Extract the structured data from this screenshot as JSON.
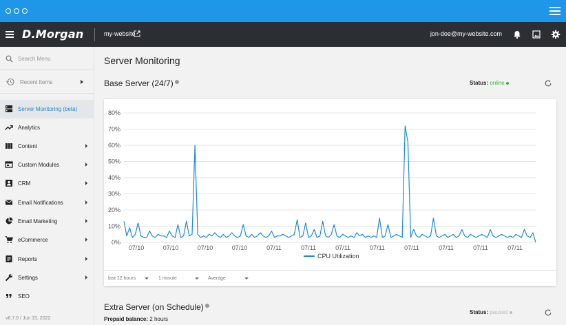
{
  "browser": {
    "menu_icon": "hamburger-icon"
  },
  "topnav": {
    "logo": "D.Morgan",
    "site": "my-website",
    "email": "jon-doe@my-website.com",
    "icons": [
      "bell-icon",
      "image-icon",
      "gear-icon"
    ]
  },
  "sidebar": {
    "search_placeholder": "Search Menu",
    "recent_label": "Recent Items",
    "items": [
      {
        "label": "Server Monitoring (beta)",
        "icon": "server-icon",
        "active": true
      },
      {
        "label": "Analytics",
        "icon": "trend-icon"
      },
      {
        "label": "Content",
        "icon": "columns-icon"
      },
      {
        "label": "Custom Modules",
        "icon": "module-icon"
      },
      {
        "label": "CRM",
        "icon": "contact-icon"
      },
      {
        "label": "Email Notifications",
        "icon": "mail-icon"
      },
      {
        "label": "Email Marketing",
        "icon": "pie-icon"
      },
      {
        "label": "eCommerce",
        "icon": "cart-icon"
      },
      {
        "label": "Reports",
        "icon": "report-icon"
      },
      {
        "label": "Settings",
        "icon": "wrench-icon"
      },
      {
        "label": "SEO",
        "icon": "quote-icon"
      }
    ],
    "version": "v6.7.0 / Jun 15, 2022"
  },
  "main": {
    "title": "Server Monitoring",
    "base": {
      "title": "Base Server (24/7)",
      "status_label": "Status:",
      "status_value": "online",
      "status_color": "#2eb82e"
    },
    "filters": [
      "last 12 hours",
      "1 minute",
      "Average"
    ],
    "extra": {
      "title": "Extra Server (on Schedule)",
      "status_label": "Status:",
      "status_value": "paused",
      "status_color": "#bbbbbb",
      "prepaid_label": "Prepaid balance:",
      "prepaid_value": "2 hours"
    }
  },
  "chart_data": {
    "type": "line",
    "ylim": [
      0,
      80
    ],
    "yticks": [
      "0%",
      "10%",
      "20%",
      "30%",
      "40%",
      "50%",
      "60%",
      "70%",
      "80%"
    ],
    "xticks": [
      "07/10",
      "07/10",
      "07/10",
      "07/10",
      "07/11",
      "07/11",
      "07/11",
      "07/11",
      "07/11",
      "07/11",
      "07/11",
      "07/11"
    ],
    "series": [
      {
        "name": "CPU Utilization",
        "color": "#1e88d8",
        "values": [
          13,
          4,
          9,
          3,
          5,
          12,
          4,
          3,
          3,
          7,
          4,
          3,
          5,
          4,
          4,
          3,
          7,
          4,
          3,
          11,
          3,
          4,
          13,
          4,
          5,
          60,
          5,
          3,
          4,
          3,
          5,
          4,
          6,
          4,
          3,
          5,
          3,
          4,
          6,
          4,
          3,
          4,
          11,
          4,
          3,
          5,
          3,
          4,
          6,
          4,
          3,
          4,
          7,
          3,
          4,
          4,
          5,
          4,
          3,
          4,
          5,
          14,
          3,
          4,
          12,
          3,
          4,
          8,
          3,
          4,
          13,
          4,
          3,
          5,
          11,
          4,
          3,
          5,
          4,
          3,
          4,
          3,
          6,
          4,
          5,
          3,
          4,
          3,
          4,
          3,
          15,
          3,
          4,
          11,
          3,
          4,
          5,
          4,
          3,
          72,
          62,
          3,
          8,
          4,
          3,
          5,
          4,
          3,
          4,
          15,
          4,
          3,
          4,
          5,
          3,
          4,
          5,
          3,
          4,
          8,
          4,
          3,
          5,
          4,
          3,
          4,
          5,
          4,
          3,
          8,
          4,
          3,
          4,
          5,
          4,
          3,
          4,
          3,
          5,
          4,
          3,
          8,
          4,
          3,
          6,
          0
        ]
      }
    ],
    "legend": "bottom"
  }
}
